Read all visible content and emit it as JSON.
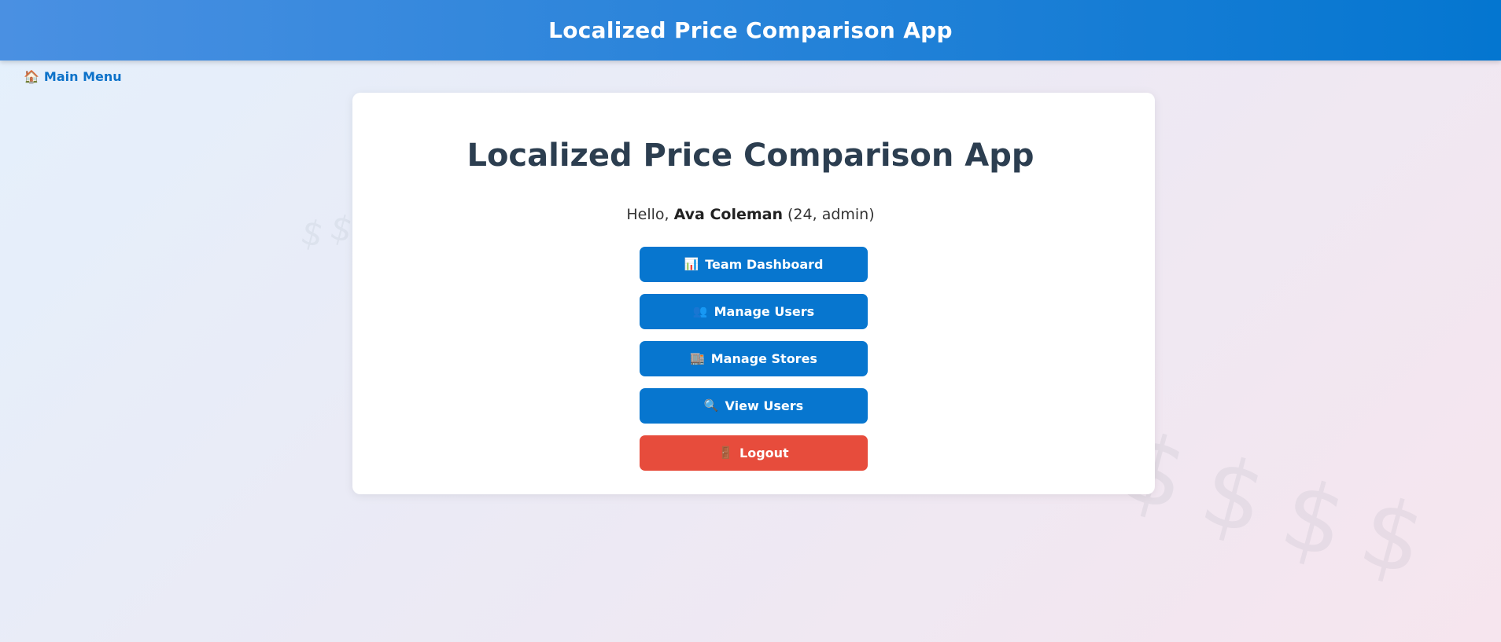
{
  "header": {
    "title": "Localized Price Comparison App"
  },
  "nav": {
    "main_menu_icon": "🏠",
    "main_menu_label": "Main Menu"
  },
  "background": {
    "symbol": "$"
  },
  "card": {
    "title": "Localized Price Comparison App",
    "greeting": {
      "prefix": "Hello, ",
      "name": "Ava Coleman",
      "details": " (24, admin)"
    },
    "buttons": [
      {
        "label": "Team Dashboard",
        "icon": "📊",
        "icon_name": "chart-icon",
        "color": "#0776cf"
      },
      {
        "label": "Manage Users",
        "icon": "👥",
        "icon_name": "users-icon",
        "color": "#0776cf"
      },
      {
        "label": "Manage Stores",
        "icon": "🏬",
        "icon_name": "store-icon",
        "color": "#0776cf"
      },
      {
        "label": "View Users",
        "icon": "🔍",
        "icon_name": "search-icon",
        "color": "#0776cf"
      },
      {
        "label": "Logout",
        "icon": "🚪",
        "icon_name": "door-icon",
        "color": "#e74c3c"
      }
    ]
  },
  "colors": {
    "header_start": "#4a90e2",
    "header_end": "#0476d0",
    "primary_button": "#0776cf",
    "danger_button": "#e74c3c",
    "link": "#0d72c9",
    "title_text": "#2c3e50"
  }
}
